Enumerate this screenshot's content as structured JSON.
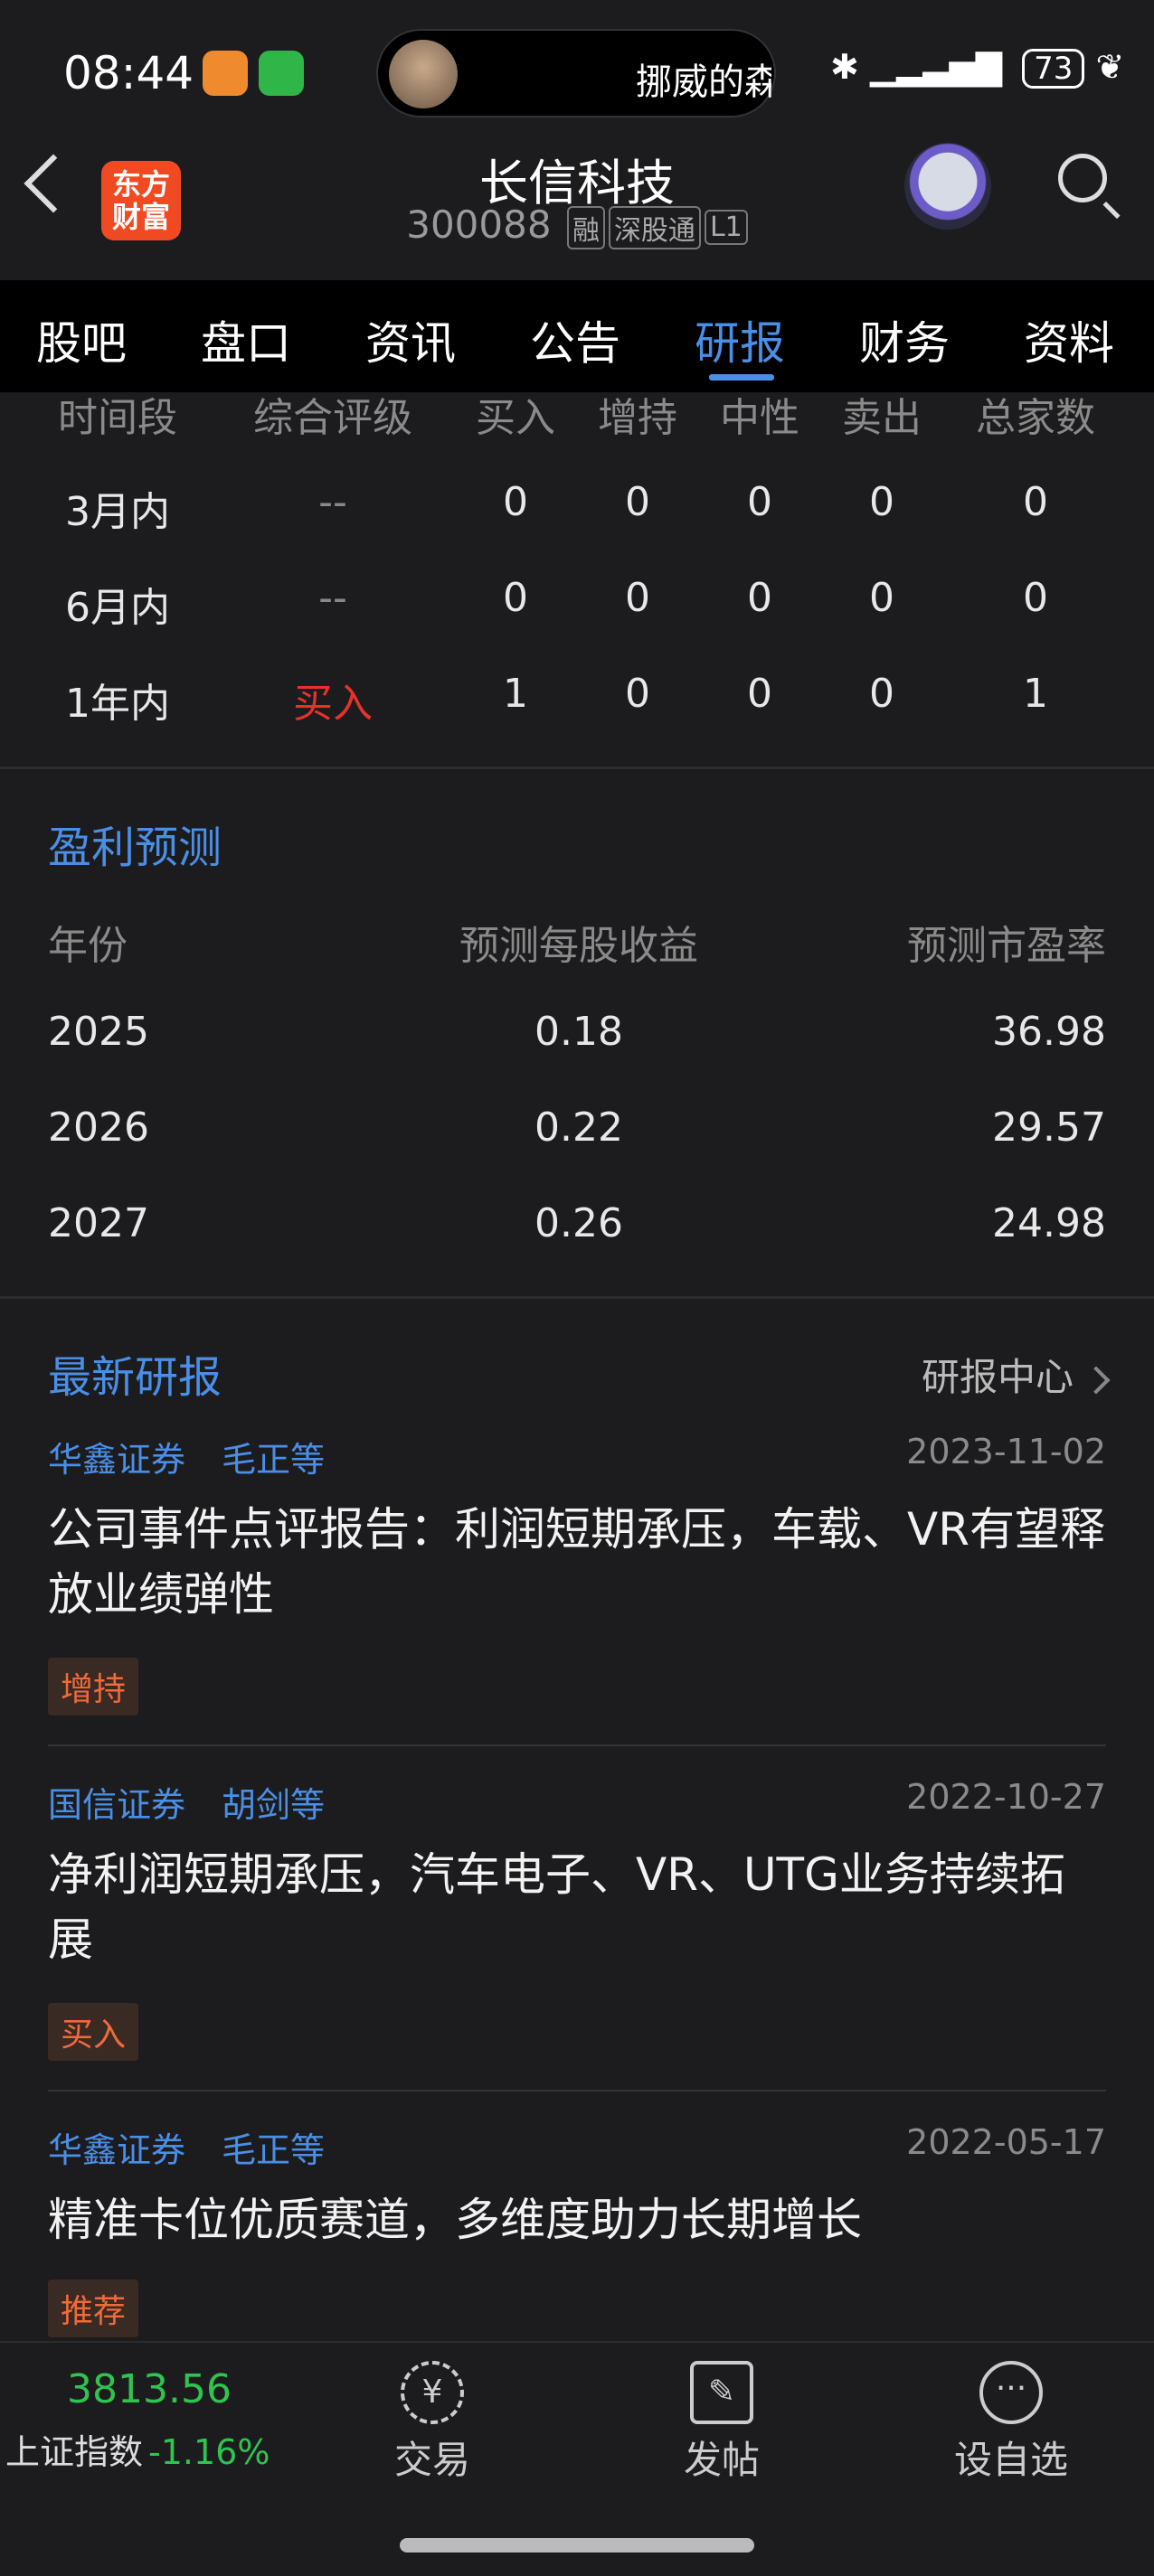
{
  "status": {
    "time": "08:44",
    "now_playing": "挪威的森",
    "battery": "73"
  },
  "header": {
    "logo_text": "东方\n财富",
    "stock_name": "长信科技",
    "stock_code": "300088",
    "tags": [
      "融",
      "深股通",
      "L1"
    ]
  },
  "tabs": [
    "股吧",
    "盘口",
    "资讯",
    "公告",
    "研报",
    "财务",
    "资料"
  ],
  "active_tab": "研报",
  "rating": {
    "headers": [
      "时间段",
      "综合评级",
      "买入",
      "增持",
      "中性",
      "卖出",
      "总家数"
    ],
    "rows": [
      [
        "3月内",
        "--",
        "0",
        "0",
        "0",
        "0",
        "0"
      ],
      [
        "6月内",
        "--",
        "0",
        "0",
        "0",
        "0",
        "0"
      ],
      [
        "1年内",
        "买入",
        "1",
        "0",
        "0",
        "0",
        "1"
      ]
    ]
  },
  "forecast": {
    "title": "盈利预测",
    "headers": [
      "年份",
      "预测每股收益",
      "预测市盈率"
    ],
    "rows": [
      [
        "2025",
        "0.18",
        "36.98"
      ],
      [
        "2026",
        "0.22",
        "29.57"
      ],
      [
        "2027",
        "0.26",
        "24.98"
      ]
    ]
  },
  "reports": {
    "title": "最新研报",
    "more_label": "研报中心",
    "items": [
      {
        "broker": "华鑫证券",
        "author": "毛正等",
        "date": "2023-11-02",
        "title": "公司事件点评报告：利润短期承压，车载、VR有望释放业绩弹性",
        "rating": "增持"
      },
      {
        "broker": "国信证券",
        "author": "胡剑等",
        "date": "2022-10-27",
        "title": "净利润短期承压，汽车电子、VR、UTG业务持续拓展",
        "rating": "买入"
      },
      {
        "broker": "华鑫证券",
        "author": "毛正等",
        "date": "2022-05-17",
        "title": "精准卡位优质赛道，多维度助力长期增长",
        "rating": "推荐"
      }
    ]
  },
  "bottom": {
    "index_value": "3813.56",
    "index_name": "上证指数",
    "index_change": "-1.16%",
    "nav": [
      {
        "label": "交易",
        "icon": "¥"
      },
      {
        "label": "发帖",
        "icon": "✎"
      },
      {
        "label": "设自选",
        "icon": "···"
      }
    ]
  },
  "colors": {
    "accent": "#4a8fe6",
    "buy": "#e8312c",
    "up_green": "#2fc44f",
    "tag_orange": "#f06a3a"
  }
}
